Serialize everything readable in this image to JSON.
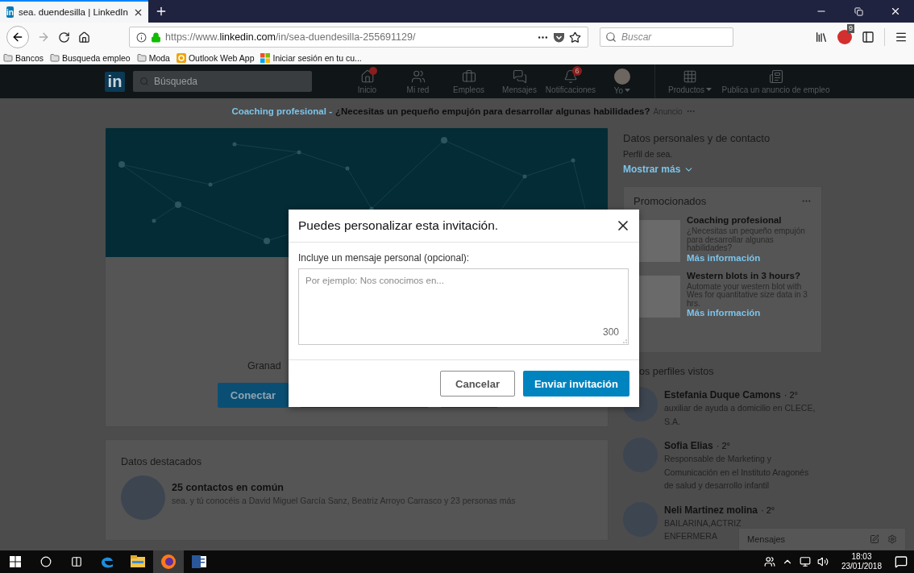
{
  "browser": {
    "tab": {
      "icon_text": "in",
      "title": "sea. duendesilla | LinkedIn"
    },
    "url": {
      "prefix": "https://www.",
      "domain": "linkedin.com",
      "path": "/in/sea-duendesilla-255691129/"
    },
    "search": {
      "placeholder": "Buscar"
    },
    "addon_badge": "9",
    "bookmarks": [
      {
        "kind": "folder",
        "label": "Bancos"
      },
      {
        "kind": "folder",
        "label": "Busqueda empleo"
      },
      {
        "kind": "folder",
        "label": "Moda"
      },
      {
        "kind": "outlook",
        "label": "Outlook Web App"
      },
      {
        "kind": "windows",
        "label": "Iniciar sesión en tu cu..."
      }
    ]
  },
  "header": {
    "logo": "in",
    "search": {
      "placeholder": "Búsqueda"
    },
    "nav": [
      {
        "kind": "home",
        "label": "Inicio",
        "dot": true
      },
      {
        "kind": "network",
        "label": "Mi red",
        "dot": false
      },
      {
        "kind": "jobs",
        "label": "Empleos",
        "dot": false
      },
      {
        "kind": "messages",
        "label": "Mensajes",
        "dot": false
      },
      {
        "kind": "bell",
        "label": "Notificaciones",
        "dot": false,
        "badge": "6"
      },
      {
        "kind": "avatar",
        "label": "Yo",
        "dot": false,
        "caret": true
      },
      {
        "kind": "grid",
        "label": "Productos",
        "dot": false,
        "caret": true
      },
      {
        "kind": "post",
        "label": "Publica un anuncio de empleo",
        "dot": false
      }
    ]
  },
  "ad_line": {
    "sponsor": "Coaching profesional -",
    "text": "¿Necesitas un pequeño empujón para desarrollar algunas habilidades?",
    "label": "Anuncio"
  },
  "profile": {
    "location": "Granad",
    "actions": [
      {
        "kind": "primary",
        "label": "Conectar"
      },
      {
        "kind": "outline"
      },
      {
        "kind": "outline-small"
      }
    ]
  },
  "highlights": {
    "title": "Datos destacados",
    "heading": "25 contactos en común",
    "text": "sea. y tú conocéis a David Miguel García Sanz, Beatriz Arroyo Carrasco y 23 personas más"
  },
  "contact": {
    "title": "Datos personales y de contacto",
    "text": "Perfil de sea.",
    "link": "Mostrar más"
  },
  "promoted": {
    "title": "Promocionados",
    "ads": [
      {
        "title": "Coaching profesional",
        "text": "¿Necesitas un pequeño empujón para desarrollar algunas habilidades?",
        "link": "Más información"
      },
      {
        "title": "Western blots in 3 hours?",
        "text": "Automate your western blot with Wes for quantitative size data in 3 hrs.",
        "link": "Más información"
      }
    ]
  },
  "viewed": {
    "title": "os perfiles vistos",
    "profiles": [
      {
        "name": "Estefania Duque Camons",
        "degree": "· 2°",
        "lines": [
          "auxiliar de ayuda a domicilio en CLECE,",
          "S.A."
        ]
      },
      {
        "name": "Sofia Elias",
        "degree": "· 2°",
        "lines": [
          "Responsable de Marketing y",
          "Comunicación en el Instituto Aragonés",
          "de salud y desarrollo infantil"
        ]
      },
      {
        "name": "Neli Martinez molina",
        "degree": "· 2°",
        "lines": [
          "BAILARINA,ACTRIZ",
          "ENFERMERA"
        ]
      }
    ]
  },
  "messaging": {
    "title": "Mensajes"
  },
  "modal": {
    "title": "Puedes personalizar esta invitación.",
    "label": "Incluye un mensaje personal (opcional):",
    "placeholder": "Por ejemplo: Nos conocimos en...",
    "counter": "300",
    "buttons": [
      {
        "kind": "secondary",
        "label": "Cancelar"
      },
      {
        "kind": "primary",
        "label": "Enviar invitación"
      }
    ]
  },
  "taskbar": {
    "apps": [
      {
        "kind": "edge",
        "selected": false
      },
      {
        "kind": "explorer",
        "selected": false
      },
      {
        "kind": "firefox",
        "selected": true
      },
      {
        "kind": "word",
        "selected": false
      }
    ],
    "time": "18:03",
    "date": "23/01/2018"
  }
}
